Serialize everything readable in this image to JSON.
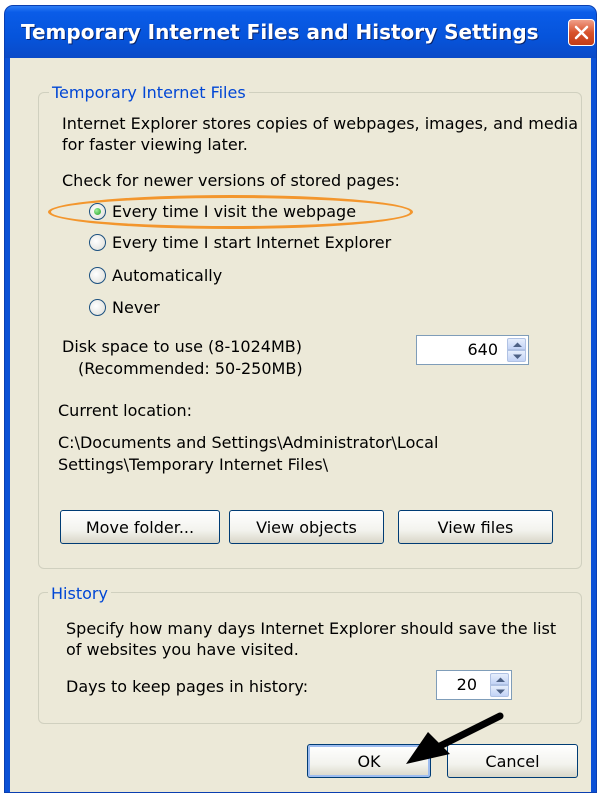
{
  "window": {
    "title": "Temporary Internet Files and History Settings"
  },
  "temp_files": {
    "legend": "Temporary Internet Files",
    "description_line1": "Internet Explorer stores copies of webpages, images, and media",
    "description_line2": "for faster viewing later.",
    "check_label": "Check for newer versions of stored pages:",
    "options": [
      {
        "label": "Every time I visit the webpage",
        "selected": true
      },
      {
        "label": "Every time I start Internet Explorer",
        "selected": false
      },
      {
        "label": "Automatically",
        "selected": false
      },
      {
        "label": "Never",
        "selected": false
      }
    ],
    "disk_space_label": "Disk space to use (8-1024MB)",
    "disk_space_recommended": "(Recommended: 50-250MB)",
    "disk_space_value": "640",
    "current_location_label": "Current location:",
    "location_line1": "C:\\Documents and Settings\\Administrator\\Local",
    "location_line2": "Settings\\Temporary Internet Files\\",
    "buttons": {
      "move_folder": "Move folder...",
      "view_objects": "View objects",
      "view_files": "View files"
    }
  },
  "history": {
    "legend": "History",
    "description_line1": "Specify how many days Internet Explorer should save the list",
    "description_line2": "of websites you have visited.",
    "days_label": "Days to keep pages in history:",
    "days_value": "20"
  },
  "footer": {
    "ok": "OK",
    "cancel": "Cancel"
  },
  "icons": {
    "close": "close-icon",
    "spin_up": "chevron-up-icon",
    "spin_down": "chevron-down-icon",
    "annotation": "arrow-annotation"
  },
  "colors": {
    "titlebar": "#0654db",
    "legend": "#0046d5",
    "highlight_ellipse": "#f3962d",
    "close_button": "#d8532c"
  }
}
